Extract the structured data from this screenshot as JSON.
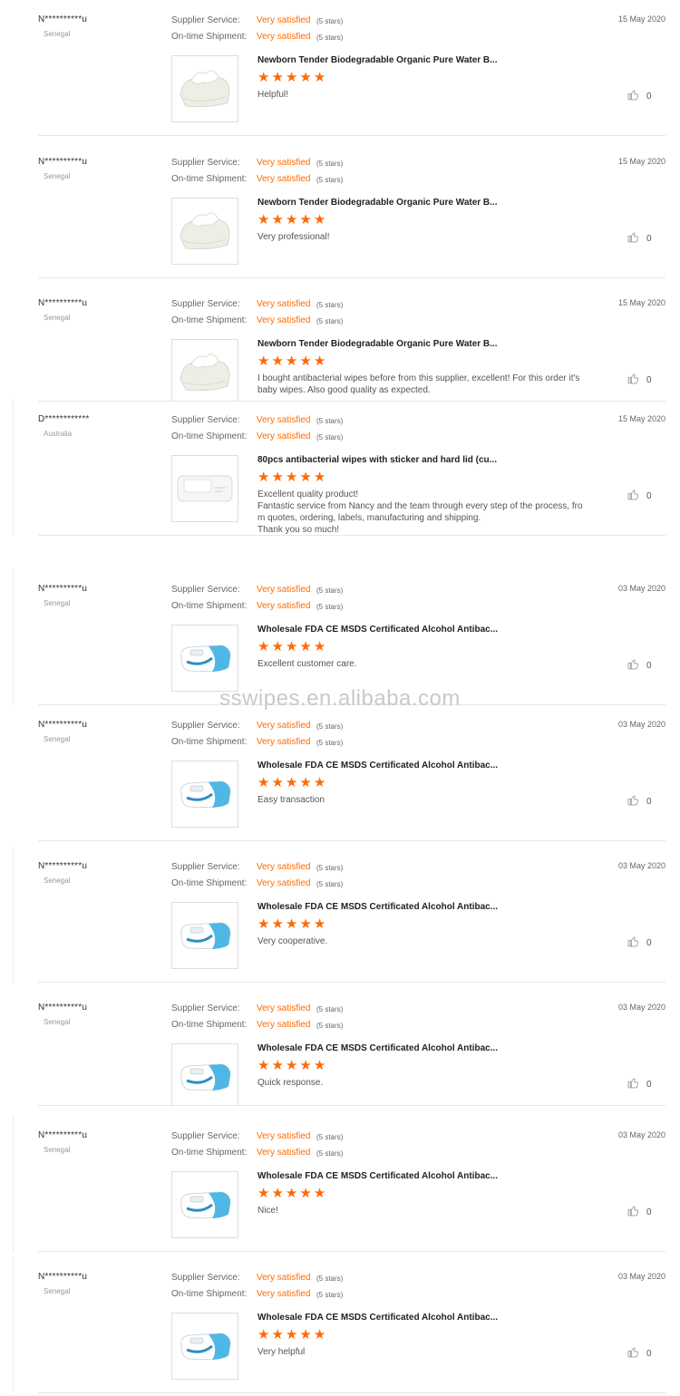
{
  "labels": {
    "supplier_service": "Supplier Service:",
    "ontime_shipment": "On-time Shipment:"
  },
  "watermark": "sswipes.en.alibaba.com",
  "reviews": [
    {
      "buyer": "N**********u",
      "country": "Senegal",
      "date": "15 May 2020",
      "supplier_value": "Very satisfied",
      "supplier_stars": "(5 stars)",
      "shipment_value": "Very satisfied",
      "shipment_stars": "(5 stars)",
      "product": "Newborn Tender Biodegradable Organic Pure Water B...",
      "product_image": "pack-wipes-white",
      "rating": 5,
      "comment": "Helpful!",
      "likes": "0"
    },
    {
      "buyer": "N**********u",
      "country": "Senegal",
      "date": "15 May 2020",
      "supplier_value": "Very satisfied",
      "supplier_stars": "(5 stars)",
      "shipment_value": "Very satisfied",
      "shipment_stars": "(5 stars)",
      "product": "Newborn Tender Biodegradable Organic Pure Water B...",
      "product_image": "pack-wipes-white",
      "rating": 5,
      "comment": "Very professional!",
      "likes": "0"
    },
    {
      "buyer": "N**********u",
      "country": "Senegal",
      "date": "15 May 2020",
      "supplier_value": "Very satisfied",
      "supplier_stars": "(5 stars)",
      "shipment_value": "Very satisfied",
      "shipment_stars": "(5 stars)",
      "product": "Newborn Tender Biodegradable Organic Pure Water B...",
      "product_image": "pack-wipes-white",
      "rating": 5,
      "comment": "I bought antibacterial wipes before from this supplier, excellent! For this order it's\nbaby wipes. Also good quality as expected.",
      "likes": "0"
    },
    {
      "buyer": "D************",
      "country": "Australia",
      "date": "15 May 2020",
      "supplier_value": "Very satisfied",
      "supplier_stars": "(5 stars)",
      "shipment_value": "Very satisfied",
      "shipment_stars": "(5 stars)",
      "product": "80pcs antibacterial wipes with sticker and hard lid (cu...",
      "product_image": "pack-wipes-hardlid",
      "rating": 5,
      "comment": "Excellent quality product!\nFantastic service from Nancy and the team through every step of the process, fro\nm quotes, ordering, labels, manufacturing and shipping.\nThank you so much!",
      "likes": "0"
    },
    {
      "buyer": "N**********u",
      "country": "Senegal",
      "date": "03 May 2020",
      "supplier_value": "Very satisfied",
      "supplier_stars": "(5 stars)",
      "shipment_value": "Very satisfied",
      "shipment_stars": "(5 stars)",
      "product": "Wholesale FDA CE MSDS Certificated Alcohol Antibac...",
      "product_image": "pack-wipes-blue",
      "rating": 5,
      "comment": "Excellent customer care.",
      "likes": "0"
    },
    {
      "buyer": "N**********u",
      "country": "Senegal",
      "date": "03 May 2020",
      "supplier_value": "Very satisfied",
      "supplier_stars": "(5 stars)",
      "shipment_value": "Very satisfied",
      "shipment_stars": "(5 stars)",
      "product": "Wholesale FDA CE MSDS Certificated Alcohol Antibac...",
      "product_image": "pack-wipes-blue",
      "rating": 5,
      "comment": "Easy transaction",
      "likes": "0"
    },
    {
      "buyer": "N**********u",
      "country": "Senegal",
      "date": "03 May 2020",
      "supplier_value": "Very satisfied",
      "supplier_stars": "(5 stars)",
      "shipment_value": "Very satisfied",
      "shipment_stars": "(5 stars)",
      "product": "Wholesale FDA CE MSDS Certificated Alcohol Antibac...",
      "product_image": "pack-wipes-blue",
      "rating": 5,
      "comment": "Very cooperative.",
      "likes": "0"
    },
    {
      "buyer": "N**********u",
      "country": "Senegal",
      "date": "03 May 2020",
      "supplier_value": "Very satisfied",
      "supplier_stars": "(5 stars)",
      "shipment_value": "Very satisfied",
      "shipment_stars": "(5 stars)",
      "product": "Wholesale FDA CE MSDS Certificated Alcohol Antibac...",
      "product_image": "pack-wipes-blue",
      "rating": 5,
      "comment": "Quick response.",
      "likes": "0"
    },
    {
      "buyer": "N**********u",
      "country": "Senegal",
      "date": "03 May 2020",
      "supplier_value": "Very satisfied",
      "supplier_stars": "(5 stars)",
      "shipment_value": "Very satisfied",
      "shipment_stars": "(5 stars)",
      "product": "Wholesale FDA CE MSDS Certificated Alcohol Antibac...",
      "product_image": "pack-wipes-blue",
      "rating": 5,
      "comment": "Nice!",
      "likes": "0"
    },
    {
      "buyer": "N**********u",
      "country": "Senegal",
      "date": "03 May 2020",
      "supplier_value": "Very satisfied",
      "supplier_stars": "(5 stars)",
      "shipment_value": "Very satisfied",
      "shipment_stars": "(5 stars)",
      "product": "Wholesale FDA CE MSDS Certificated Alcohol Antibac...",
      "product_image": "pack-wipes-blue",
      "rating": 5,
      "comment": "Very helpful",
      "likes": "0"
    }
  ]
}
